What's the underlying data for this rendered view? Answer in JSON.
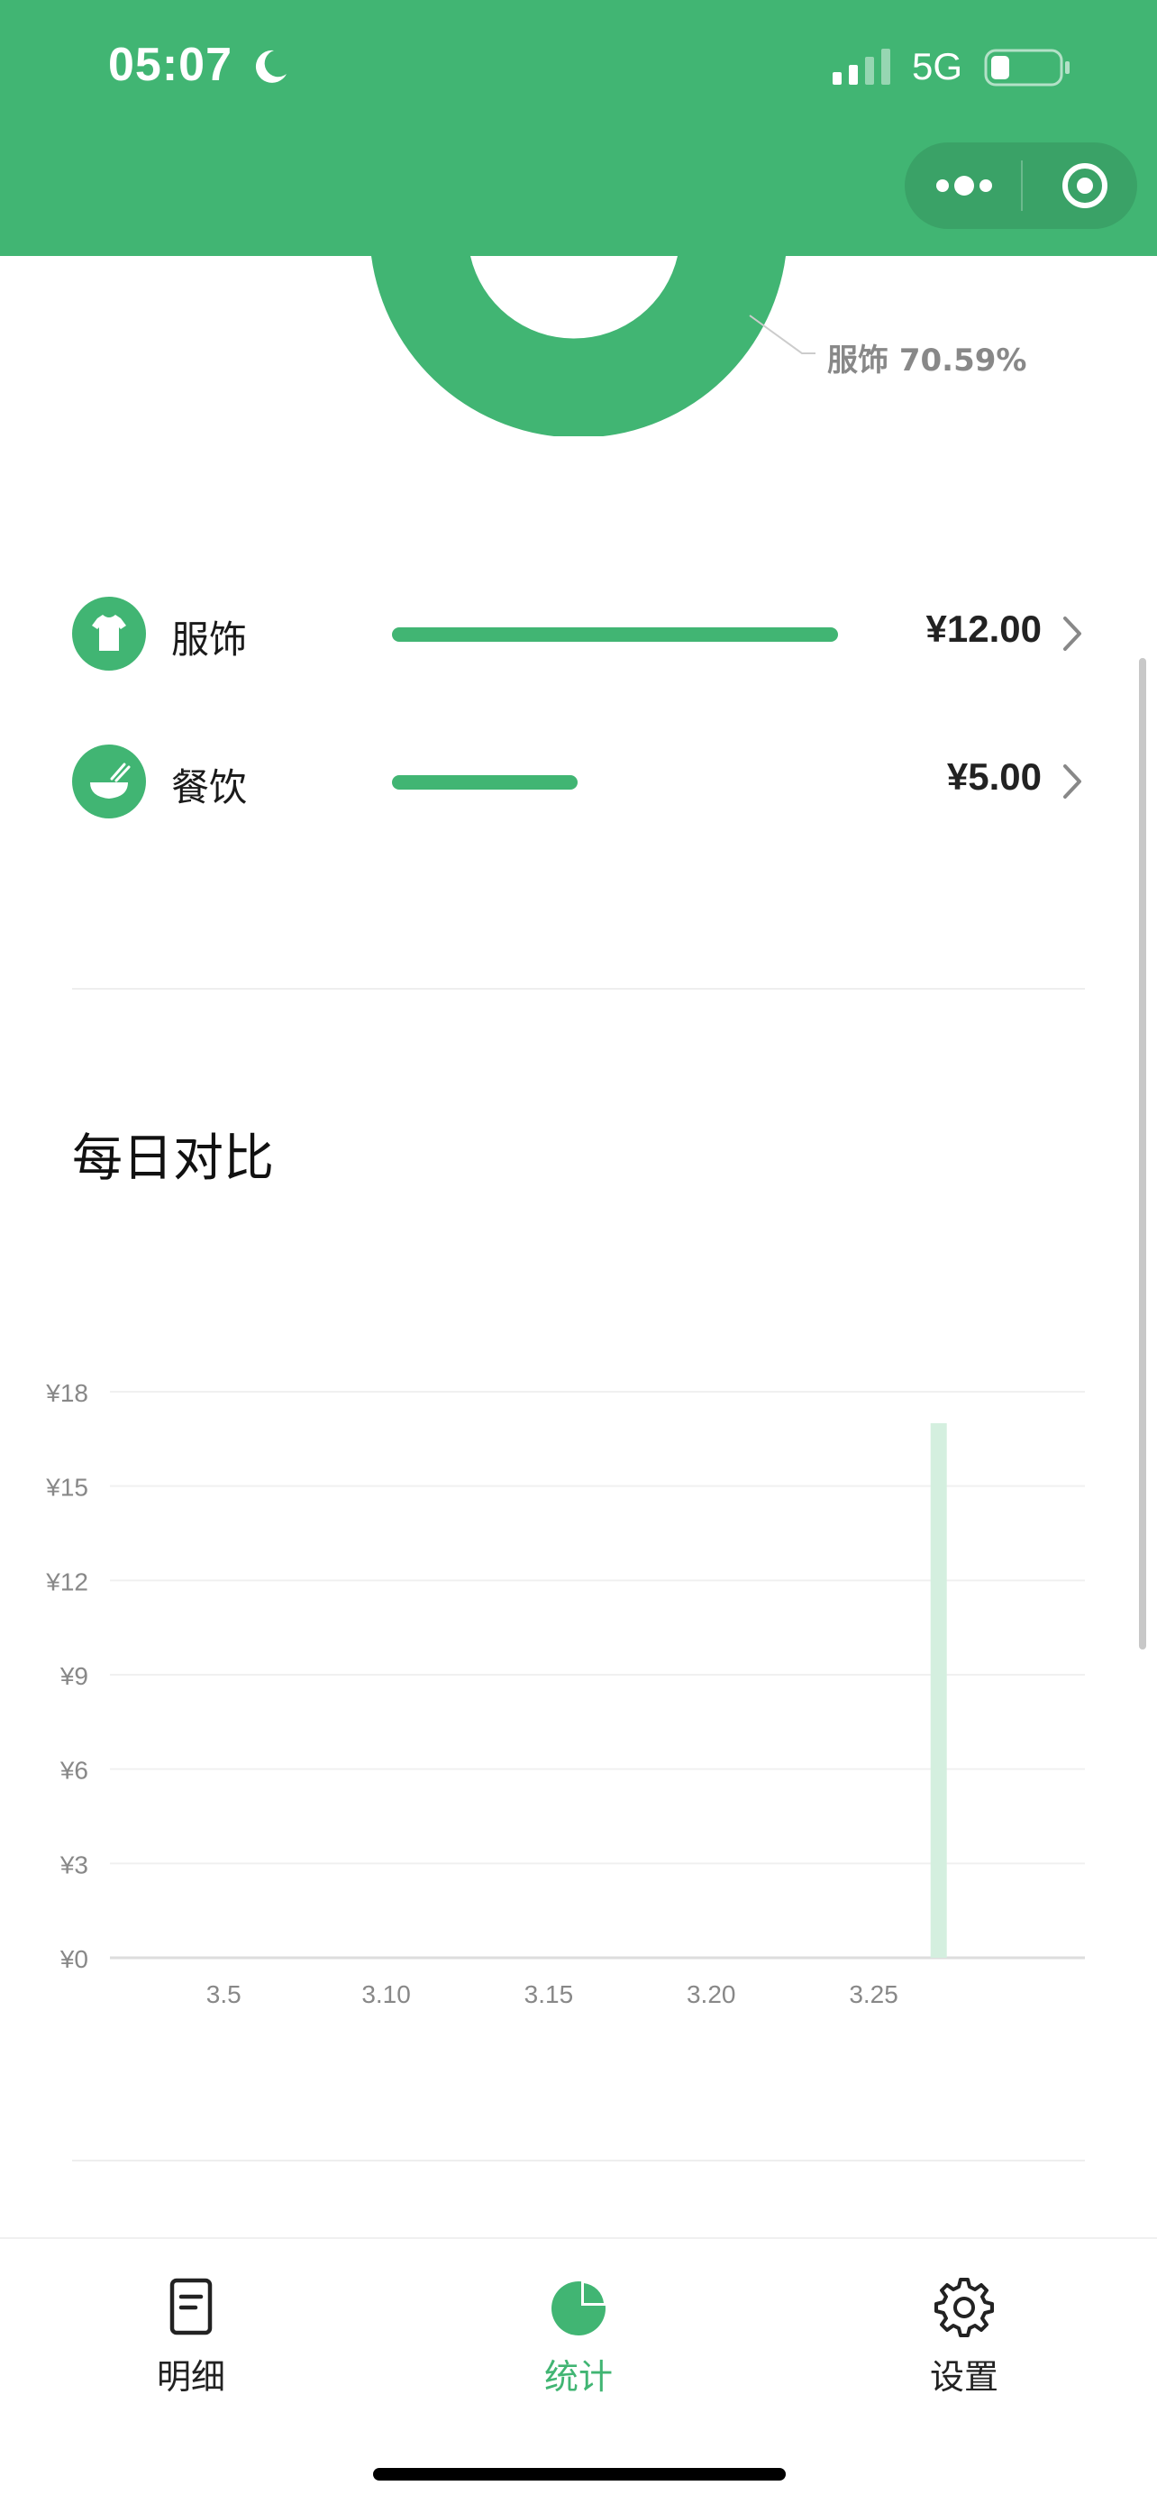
{
  "status_bar": {
    "time": "05:07",
    "network": "5G",
    "icons": [
      "moon-icon",
      "signal-icon",
      "battery-icon"
    ]
  },
  "capsule": {
    "icons": [
      "more-dots-icon",
      "close-target-icon"
    ]
  },
  "donut_label": "服饰 70.59%",
  "categories": [
    {
      "name": "服饰",
      "amount": "¥12.00",
      "icon": "shirt-icon",
      "fraction": 1.0
    },
    {
      "name": "餐饮",
      "amount": "¥5.00",
      "icon": "bowl-icon",
      "fraction": 0.4167
    }
  ],
  "section_title": "每日对比",
  "chart_data": {
    "type": "bar",
    "title": "每日对比",
    "y_ticks": [
      "¥0",
      "¥3",
      "¥6",
      "¥9",
      "¥12",
      "¥15",
      "¥18"
    ],
    "ylim": [
      0,
      18
    ],
    "x_ticks": [
      "3.5",
      "3.10",
      "3.15",
      "3.20",
      "3.25"
    ],
    "xlim": [
      1.5,
      31.5
    ],
    "bars": [
      {
        "x": 27,
        "value": 17
      }
    ],
    "grid": true,
    "bar_color": "#d4efdf",
    "accent": "#41b573"
  },
  "tabs": [
    {
      "label": "明细",
      "icon": "list-document-icon",
      "active": false
    },
    {
      "label": "统计",
      "icon": "pie-chart-icon",
      "active": true
    },
    {
      "label": "设置",
      "icon": "gear-icon",
      "active": false
    }
  ],
  "colors": {
    "accent": "#41b573",
    "text": "#1a1a1a",
    "muted": "#888888"
  }
}
